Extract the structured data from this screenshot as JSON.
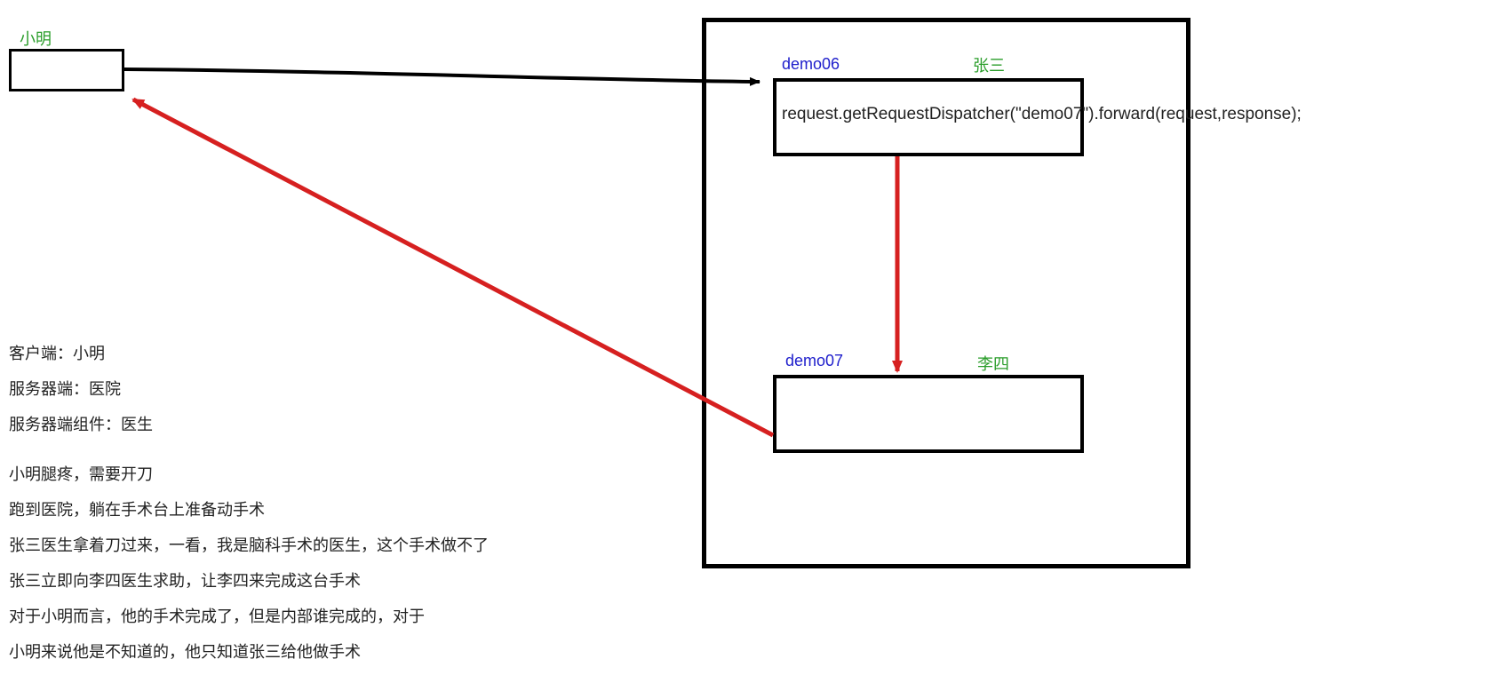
{
  "client": {
    "name": "小明"
  },
  "server": {
    "demo06": {
      "id": "demo06",
      "person": "张三",
      "code": "request.getRequestDispatcher(\"demo07\").forward(request,response);"
    },
    "demo07": {
      "id": "demo07",
      "person": "李四"
    }
  },
  "notes": {
    "line1": "客户端：小明",
    "line2": "服务器端：医院",
    "line3": "服务器端组件：医生",
    "line4": "小明腿疼，需要开刀",
    "line5": "跑到医院，躺在手术台上准备动手术",
    "line6": "张三医生拿着刀过来，一看，我是脑科手术的医生，这个手术做不了",
    "line7": "张三立即向李四医生求助，让李四来完成这台手术",
    "line8": "对于小明而言，他的手术完成了，但是内部谁完成的，对于",
    "line9": "小明来说他是不知道的，他只知道张三给他做手术"
  }
}
